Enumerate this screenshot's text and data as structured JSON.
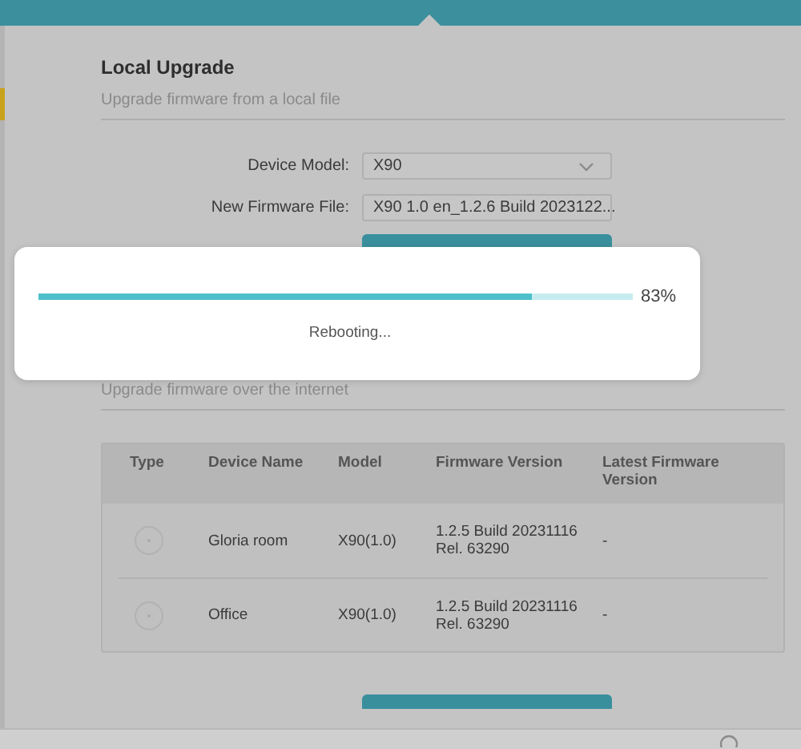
{
  "local_upgrade": {
    "title": "Local Upgrade",
    "subtitle": "Upgrade firmware from a local file",
    "device_model": {
      "label": "Device Model:",
      "value": "X90"
    },
    "firmware_file": {
      "label": "New Firmware File:",
      "value": "X90 1.0 en_1.2.6 Build 2023122..."
    }
  },
  "online_upgrade": {
    "subtitle": "Upgrade firmware over the internet",
    "table": {
      "columns": [
        "Type",
        "Device Name",
        "Model",
        "Firmware Version",
        "Latest Firmware Version"
      ],
      "rows": [
        {
          "selected": false,
          "device_name": "Gloria room",
          "model": "X90(1.0)",
          "firmware_version": [
            "1.2.5 Build 20231116",
            "Rel. 63290"
          ],
          "latest_firmware_version": "-"
        },
        {
          "selected": false,
          "device_name": "Office",
          "model": "X90(1.0)",
          "firmware_version": [
            "1.2.5 Build 20231116",
            "Rel. 63290"
          ],
          "latest_firmware_version": "-"
        }
      ]
    }
  },
  "progress_dialog": {
    "level": 0.83,
    "percent": "83%",
    "status": "Rebooting..."
  }
}
